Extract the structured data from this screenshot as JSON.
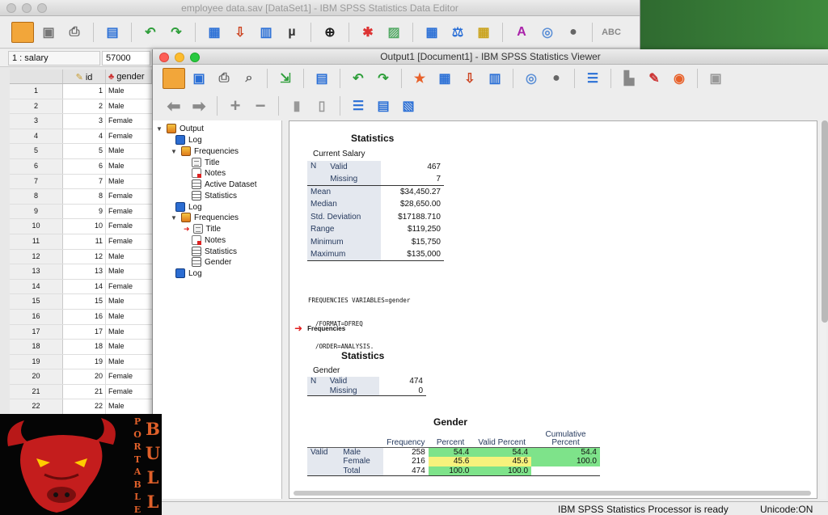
{
  "editor": {
    "title": "employee data.sav [DataSet1] - IBM SPSS Statistics Data Editor",
    "cell_ref": "1 : salary",
    "cell_value": "57000",
    "col_id": "id",
    "col_gender": "gender",
    "rows": [
      {
        "n": "1",
        "id": "1",
        "g": "Male"
      },
      {
        "n": "2",
        "id": "2",
        "g": "Male"
      },
      {
        "n": "3",
        "id": "3",
        "g": "Female"
      },
      {
        "n": "4",
        "id": "4",
        "g": "Female"
      },
      {
        "n": "5",
        "id": "5",
        "g": "Male"
      },
      {
        "n": "6",
        "id": "6",
        "g": "Male"
      },
      {
        "n": "7",
        "id": "7",
        "g": "Male"
      },
      {
        "n": "8",
        "id": "8",
        "g": "Female"
      },
      {
        "n": "9",
        "id": "9",
        "g": "Female"
      },
      {
        "n": "10",
        "id": "10",
        "g": "Female"
      },
      {
        "n": "11",
        "id": "11",
        "g": "Female"
      },
      {
        "n": "12",
        "id": "12",
        "g": "Male"
      },
      {
        "n": "13",
        "id": "13",
        "g": "Male"
      },
      {
        "n": "14",
        "id": "14",
        "g": "Female"
      },
      {
        "n": "15",
        "id": "15",
        "g": "Male"
      },
      {
        "n": "16",
        "id": "16",
        "g": "Male"
      },
      {
        "n": "17",
        "id": "17",
        "g": "Male"
      },
      {
        "n": "18",
        "id": "18",
        "g": "Male"
      },
      {
        "n": "19",
        "id": "19",
        "g": "Male"
      },
      {
        "n": "20",
        "id": "20",
        "g": "Female"
      },
      {
        "n": "21",
        "id": "21",
        "g": "Female"
      },
      {
        "n": "22",
        "id": "22",
        "g": "Male"
      }
    ]
  },
  "viewer": {
    "title": "Output1 [Document1] - IBM SPSS Statistics Viewer",
    "tree": {
      "output": "Output",
      "log": "Log",
      "frequencies": "Frequencies",
      "title": "Title",
      "notes": "Notes",
      "active_dataset": "Active Dataset",
      "statistics": "Statistics",
      "gender": "Gender"
    },
    "stats1": {
      "title": "Statistics",
      "subtitle": "Current Salary",
      "n": "N",
      "valid": "Valid",
      "missing": "Missing",
      "valid_val": "467",
      "missing_val": "7",
      "rows": [
        {
          "label": "Mean",
          "value": "$34,450.27"
        },
        {
          "label": "Median",
          "value": "$28,650.00"
        },
        {
          "label": "Std. Deviation",
          "value": "$17188.710"
        },
        {
          "label": "Range",
          "value": "$119,250"
        },
        {
          "label": "Minimum",
          "value": "$15,750"
        },
        {
          "label": "Maximum",
          "value": "$135,000"
        }
      ]
    },
    "syntax": [
      "FREQUENCIES VARIABLES=gender",
      "  /FORMAT=DFREQ",
      "  /ORDER=ANALYSIS."
    ],
    "freq_heading": "Frequencies",
    "stats2": {
      "title": "Statistics",
      "subtitle": "Gender",
      "n": "N",
      "valid": "Valid",
      "missing": "Missing",
      "valid_val": "474",
      "missing_val": "0"
    },
    "gender_table": {
      "title": "Gender",
      "headers": {
        "freq": "Frequency",
        "pct": "Percent",
        "vpct": "Valid Percent",
        "cpct": "Cumulative Percent"
      },
      "group": "Valid",
      "rows": [
        {
          "label": "Male",
          "freq": "258",
          "pct": "54.4",
          "vpct": "54.4",
          "cpct": "54.4"
        },
        {
          "label": "Female",
          "freq": "216",
          "pct": "45.6",
          "vpct": "45.6",
          "cpct": "100.0"
        },
        {
          "label": "Total",
          "freq": "474",
          "pct": "100.0",
          "vpct": "100.0",
          "cpct": ""
        }
      ]
    }
  },
  "status": {
    "processor": "IBM SPSS Statistics Processor is ready",
    "unicode": "Unicode:ON"
  },
  "logo": {
    "portable": "PORTABLE",
    "bull": "BULL"
  }
}
